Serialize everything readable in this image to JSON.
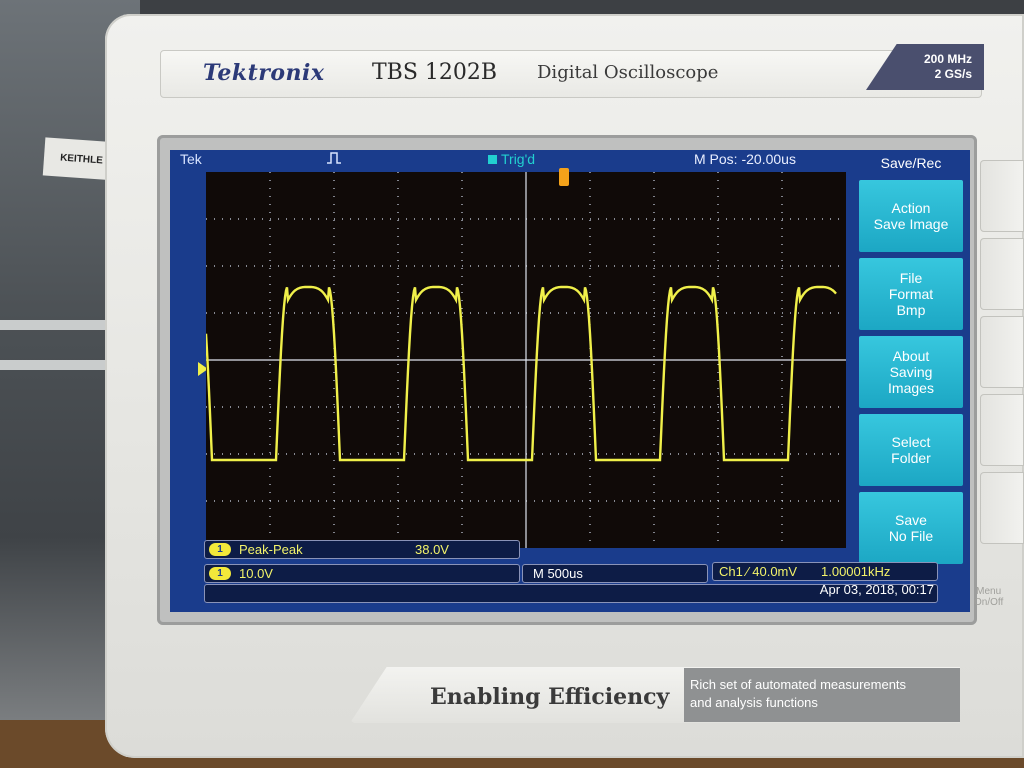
{
  "device": {
    "brand": "Tektronix",
    "model": "TBS 1202B",
    "description": "Digital Oscilloscope",
    "spec_bandwidth": "200 MHz",
    "spec_sample_rate": "2 GS/s",
    "slogan": "Enabling Efficiency",
    "feature_line1": "Rich set of automated measurements",
    "feature_line2": "and analysis functions",
    "menu_onoff_line1": "Menu",
    "menu_onoff_line2": "On/Off",
    "side_label": "KEITHLE"
  },
  "screen": {
    "tek_label": "Tek",
    "trigger_status": "Trig'd",
    "horizontal_position": "M Pos: -20.00us",
    "ch1_marker": "1",
    "trigger_marker": "T"
  },
  "menu": {
    "title": "Save/Rec",
    "buttons": [
      {
        "line1": "Action",
        "line2": "Save Image",
        "line3": ""
      },
      {
        "line1": "File",
        "line2": "Format",
        "line3": "Bmp"
      },
      {
        "line1": "About",
        "line2": "Saving",
        "line3": "Images"
      },
      {
        "line1": "Select",
        "line2": "Folder",
        "line3": ""
      },
      {
        "line1": "Save",
        "line2": "No File",
        "line3": ""
      }
    ]
  },
  "readouts": {
    "measurement_channel": "1",
    "measurement_name": "Peak-Peak",
    "measurement_value": "38.0V",
    "ch1_channel": "1",
    "ch1_scale": "10.0V",
    "timebase": "M 500us",
    "trigger_source": "Ch1 ⁄ 40.0mV",
    "trigger_frequency": "1.00001kHz",
    "datetime": "Apr 03, 2018, 00:17"
  },
  "colors": {
    "screen_bg": "#1a3c8c",
    "trace": "#f0f04a",
    "menu_button": "#28b8d2",
    "trigger_marker": "#f4a21a"
  },
  "icons": {
    "trigger_type": "rising-pulse-icon",
    "trigger_status": "square-status-icon"
  }
}
